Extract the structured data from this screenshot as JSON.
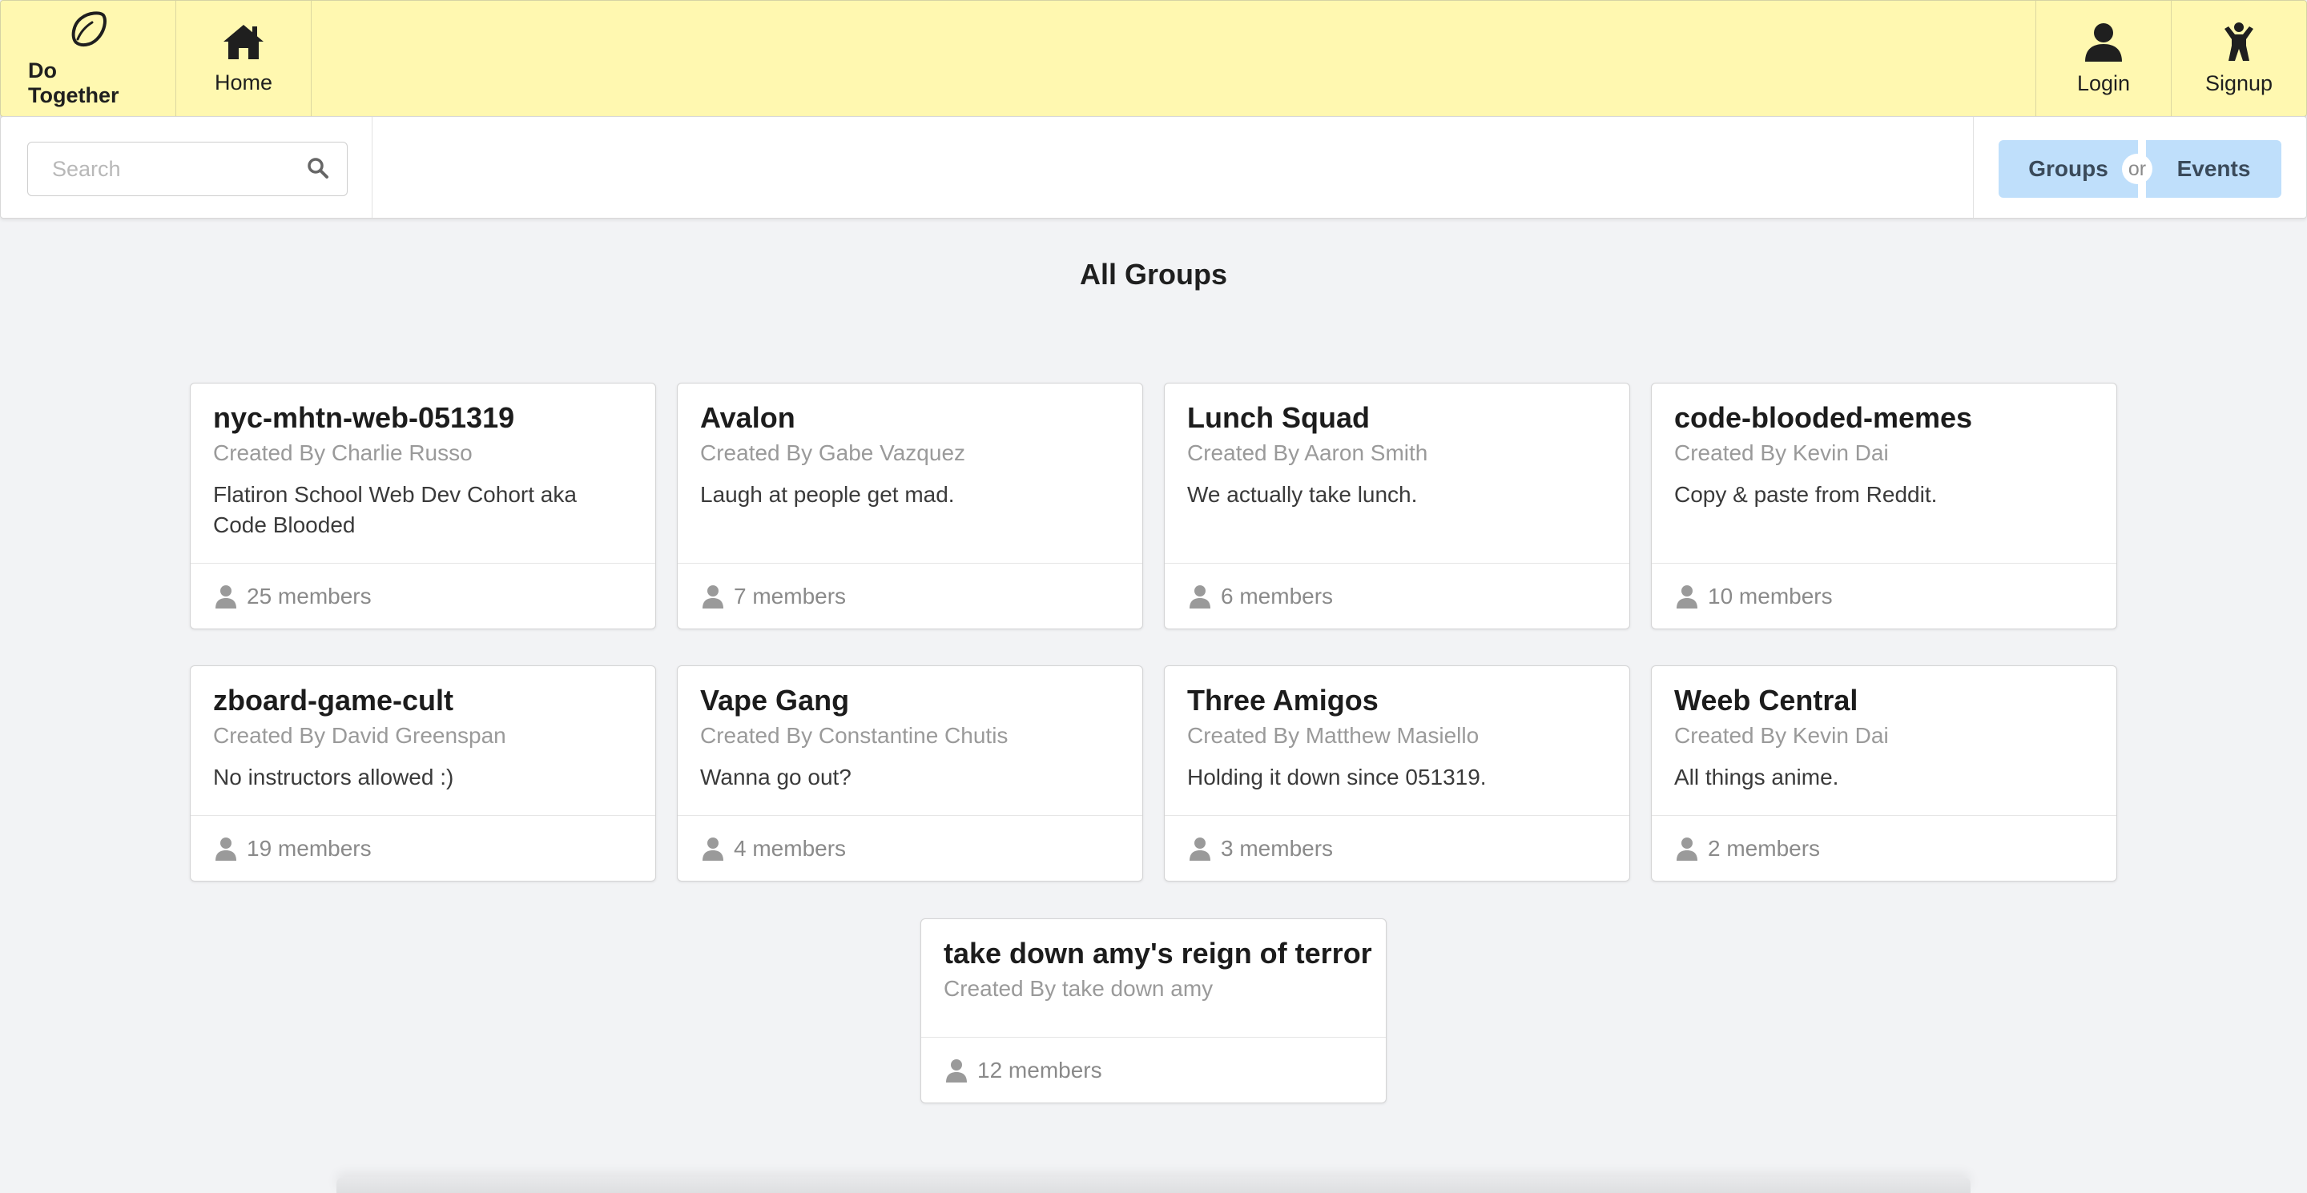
{
  "nav": {
    "brand": "Do Together",
    "home": "Home",
    "login": "Login",
    "signup": "Signup"
  },
  "search": {
    "placeholder": "Search"
  },
  "toggle": {
    "groups": "Groups",
    "or": "or",
    "events": "Events"
  },
  "page_title": "All Groups",
  "groups": [
    {
      "name": "nyc-mhtn-web-051319",
      "creator": "Created By Charlie Russo",
      "description": "Flatiron School Web Dev Cohort aka Code Blooded",
      "members": "25 members"
    },
    {
      "name": "Avalon",
      "creator": "Created By Gabe Vazquez",
      "description": "Laugh at people get mad.",
      "members": "7 members"
    },
    {
      "name": "Lunch Squad",
      "creator": "Created By Aaron Smith",
      "description": "We actually take lunch.",
      "members": "6 members"
    },
    {
      "name": "code-blooded-memes",
      "creator": "Created By Kevin Dai",
      "description": "Copy & paste from Reddit.",
      "members": "10 members"
    },
    {
      "name": "zboard-game-cult",
      "creator": "Created By David Greenspan",
      "description": "No instructors allowed :)",
      "members": "19 members"
    },
    {
      "name": "Vape Gang",
      "creator": "Created By Constantine Chutis",
      "description": "Wanna go out?",
      "members": "4 members"
    },
    {
      "name": "Three Amigos",
      "creator": "Created By Matthew Masiello",
      "description": "Holding it down since 051319.",
      "members": "3 members"
    },
    {
      "name": "Weeb Central",
      "creator": "Created By Kevin Dai",
      "description": "All things anime.",
      "members": "2 members"
    },
    {
      "name": "take down amy's reign of terror",
      "creator": "Created By take down amy",
      "description": "",
      "members": "12 members"
    }
  ],
  "colors": {
    "topbar": "#fff8b0",
    "toggle_button": "#bfdffb",
    "background": "#f2f3f5"
  }
}
